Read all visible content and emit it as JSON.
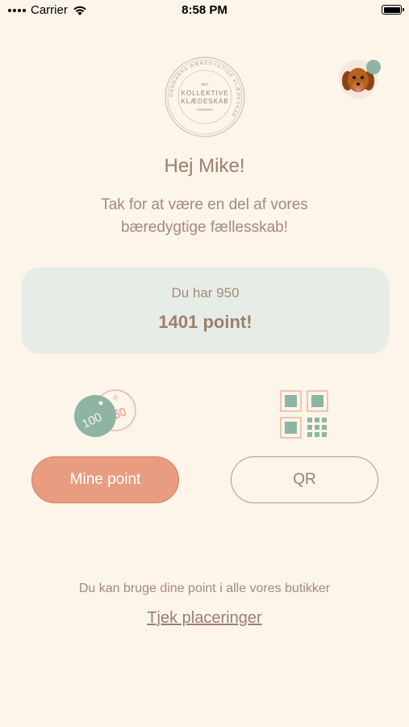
{
  "status_bar": {
    "carrier": "Carrier",
    "time": "8:58 PM"
  },
  "logo": {
    "top_text": "DET",
    "line1": "KOLLEKTIVE",
    "line2": "KLÆDESKAB",
    "bottom_text": "DANMARK",
    "ring_text": "DANMARKS BÆREDYGTIGE KLÆDESKAB"
  },
  "greeting": "Hej Mike!",
  "subtitle": "Tak for at være en del af vores bæredygtige fællesskab!",
  "points_card": {
    "line1": "Du har 950",
    "line2": "1401 point!"
  },
  "tags": {
    "front_value": "100",
    "back_value": "50"
  },
  "buttons": {
    "mine_point": "Mine point",
    "qr": "QR"
  },
  "info_text": "Du kan bruge dine point i alle vores butikker",
  "locations_link": "Tjek placeringer",
  "colors": {
    "background": "#fdf4ea",
    "card": "#e6ece6",
    "accent": "#e89d80",
    "green": "#8fb4a3",
    "text": "#9c7f6f"
  }
}
